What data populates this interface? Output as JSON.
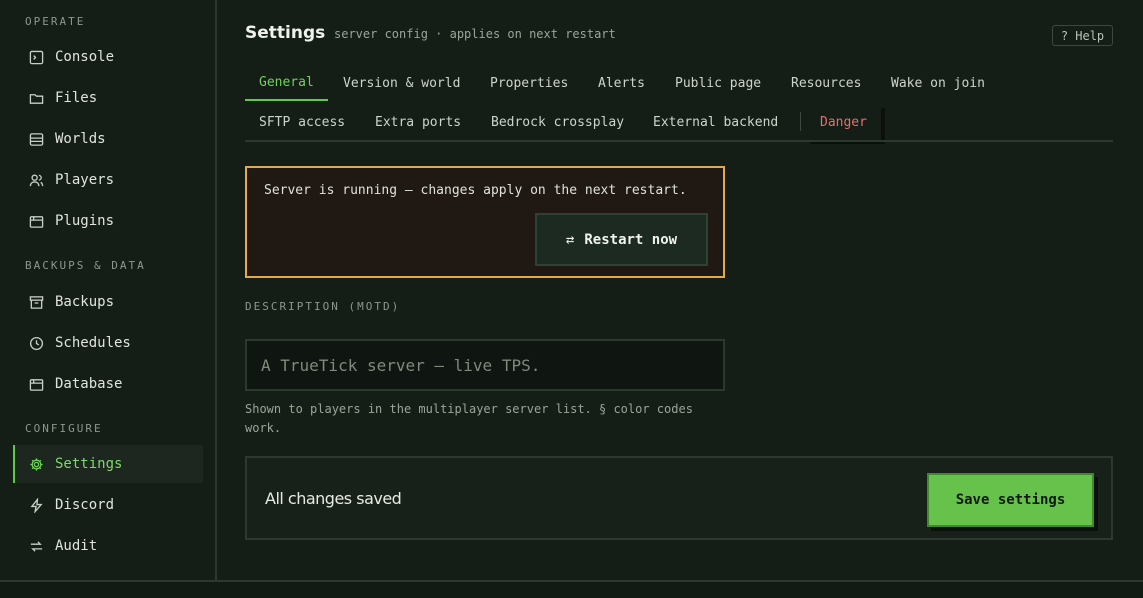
{
  "sidebar": {
    "groups": {
      "operate": "OPERATE",
      "backups": "BACKUPS & DATA",
      "configure": "CONFIGURE"
    },
    "items": {
      "console": "Console",
      "files": "Files",
      "worlds": "Worlds",
      "players": "Players",
      "plugins": "Plugins",
      "backups": "Backups",
      "schedules": "Schedules",
      "database": "Database",
      "settings": "Settings",
      "discord": "Discord",
      "audit": "Audit"
    },
    "active": "settings"
  },
  "header": {
    "title": "Settings",
    "subtitle": "server config · applies on next restart",
    "help_label": "? Help"
  },
  "tabs": {
    "general": "General",
    "version_world": "Version & world",
    "properties": "Properties",
    "alerts": "Alerts",
    "public_page": "Public page",
    "resources": "Resources",
    "wake_on_join": "Wake on join",
    "sftp": "SFTP access",
    "extra_ports": "Extra ports",
    "bedrock": "Bedrock crossplay",
    "external_backend": "External backend",
    "danger": "Danger",
    "active": "general"
  },
  "notice": {
    "text": "Server is running — changes apply on the next restart.",
    "button_icon": "⇄",
    "button_label": "Restart now"
  },
  "motd": {
    "label": "DESCRIPTION (MOTD)",
    "value": "",
    "placeholder": "A TrueTick server — live TPS.",
    "help": "Shown to players in the multiplayer server list. § color codes work."
  },
  "footer": {
    "status": "All changes saved",
    "save_label": "Save settings"
  },
  "colors": {
    "accent": "#5fc94a",
    "warning": "#e3a94a",
    "danger": "#e0706a",
    "background": "#151d17"
  }
}
